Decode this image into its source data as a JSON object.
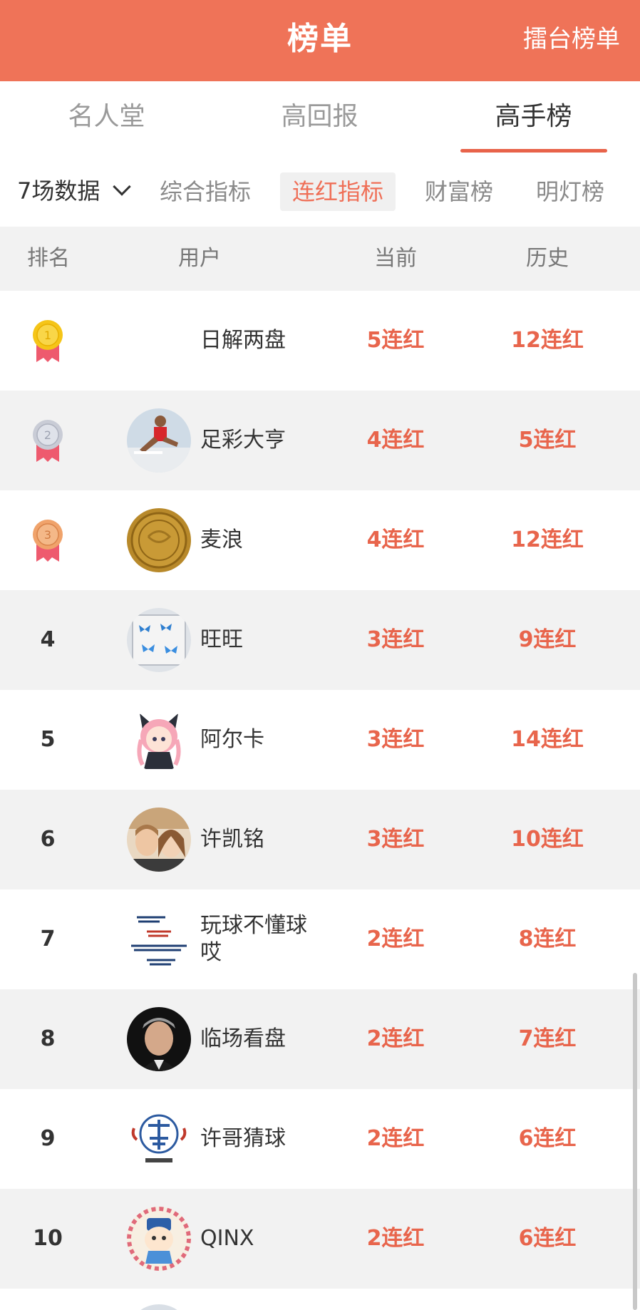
{
  "header": {
    "title": "榜单",
    "right_link": "擂台榜单"
  },
  "main_tabs": [
    {
      "label": "名人堂",
      "active": false
    },
    {
      "label": "高回报",
      "active": false
    },
    {
      "label": "高手榜",
      "active": true
    }
  ],
  "filter": {
    "selected": "7场数据"
  },
  "sub_tabs": [
    {
      "label": "综合指标",
      "active": false
    },
    {
      "label": "连红指标",
      "active": true
    },
    {
      "label": "财富榜",
      "active": false
    },
    {
      "label": "明灯榜",
      "active": false
    }
  ],
  "table": {
    "headers": {
      "rank": "排名",
      "user": "用户",
      "current": "当前",
      "history": "历史"
    },
    "rows": [
      {
        "rank": "1",
        "medal": "gold",
        "name": "日解两盘",
        "avatar": "none",
        "current": "5连红",
        "history": "12连红"
      },
      {
        "rank": "2",
        "medal": "silver",
        "name": "足彩大亨",
        "avatar": "hurdler-photo",
        "current": "4连红",
        "history": "5连红"
      },
      {
        "rank": "3",
        "medal": "bronze",
        "name": "麦浪",
        "avatar": "gold-coin",
        "current": "4连红",
        "history": "12连红"
      },
      {
        "rank": "4",
        "medal": "",
        "name": "旺旺",
        "avatar": "blue-butterflies",
        "current": "3连红",
        "history": "9连红"
      },
      {
        "rank": "5",
        "medal": "",
        "name": "阿尔卡",
        "avatar": "anime-girl",
        "current": "3连红",
        "history": "14连红"
      },
      {
        "rank": "6",
        "medal": "",
        "name": "许凯铭",
        "avatar": "couple-photo",
        "current": "3连红",
        "history": "10连红"
      },
      {
        "rank": "7",
        "medal": "",
        "name": "玩球不懂球哎",
        "avatar": "calligraphy",
        "current": "2连红",
        "history": "8连红"
      },
      {
        "rank": "8",
        "medal": "",
        "name": "临场看盘",
        "avatar": "man-portrait",
        "current": "2连红",
        "history": "7连红"
      },
      {
        "rank": "9",
        "medal": "",
        "name": "许哥猜球",
        "avatar": "seal-logo",
        "current": "2连红",
        "history": "6连红"
      },
      {
        "rank": "10",
        "medal": "",
        "name": "QINX",
        "avatar": "cartoon-boy",
        "current": "2连红",
        "history": "6连红"
      }
    ]
  },
  "colors": {
    "brand": "#ef7358",
    "accent_text": "#e8654c",
    "row_alt": "#f2f2f2",
    "gold": "#f5c518",
    "silver": "#c9ccd6",
    "bronze": "#f0a36b",
    "ribbon": "#ee5a6e"
  }
}
